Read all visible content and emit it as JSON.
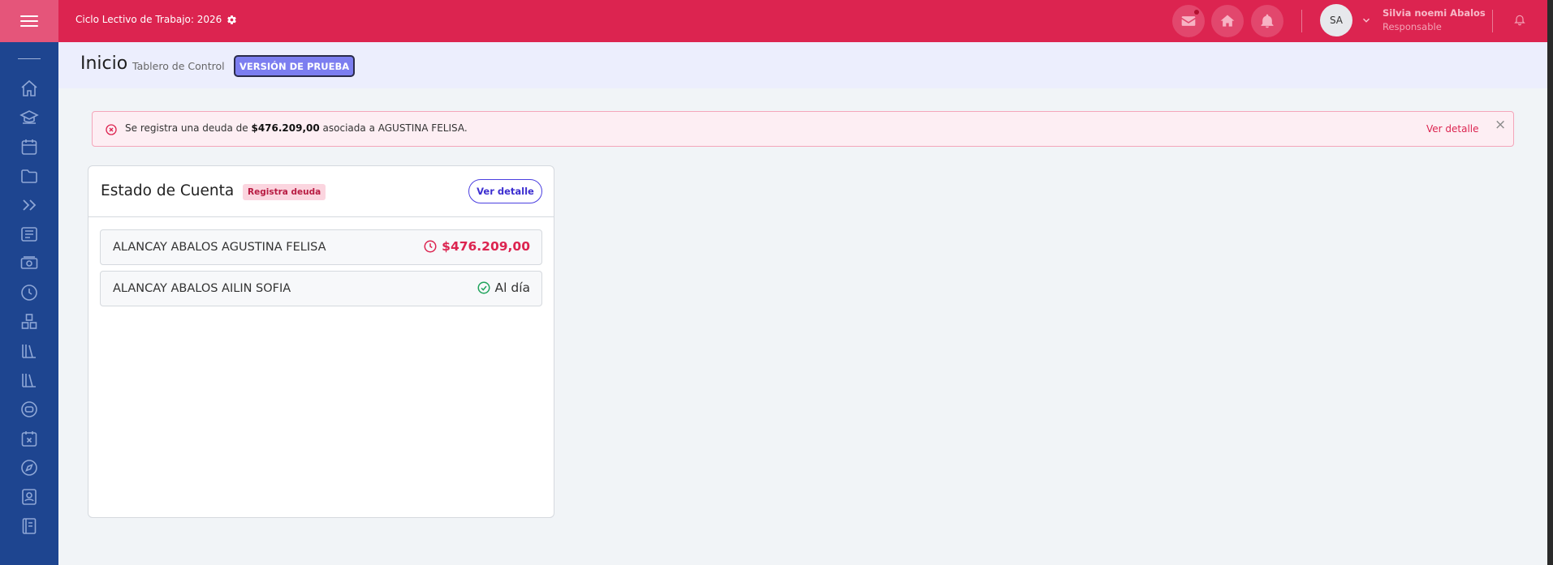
{
  "topbar": {
    "cycle_label": "Ciclo Lectivo de Trabajo: 2026",
    "user_initials": "SA",
    "user_name": "Silvia noemi Abalos",
    "user_role": "Responsable"
  },
  "sidebar": {
    "items": [
      {
        "icon": "home-icon"
      },
      {
        "icon": "graduation-icon"
      },
      {
        "icon": "calendar-icon"
      },
      {
        "icon": "folder-icon"
      },
      {
        "icon": "double-chevron-icon"
      },
      {
        "icon": "newspaper-icon"
      },
      {
        "icon": "money-icon"
      },
      {
        "icon": "clock-icon"
      },
      {
        "icon": "boxes-icon"
      },
      {
        "icon": "library-icon"
      },
      {
        "icon": "library-alt-icon"
      },
      {
        "icon": "ticket-icon"
      },
      {
        "icon": "calendar-x-icon"
      },
      {
        "icon": "compass-icon"
      },
      {
        "icon": "contact-icon"
      },
      {
        "icon": "notebook-icon"
      }
    ]
  },
  "header": {
    "title": "Inicio",
    "subtitle": "Tablero de Control",
    "badge": "VERSIÓN DE PRUEBA"
  },
  "alert": {
    "text_before": "Se registra una deuda de ",
    "amount": "$476.209,00",
    "text_after": " asociada a AGUSTINA FELISA.",
    "link": "Ver detalle",
    "close": "×"
  },
  "account_card": {
    "title": "Estado de Cuenta",
    "badge": "Registra deuda",
    "detail_button": "Ver detalle",
    "students": [
      {
        "name": "ALANCAY ABALOS AGUSTINA FELISA",
        "status": "$476.209,00",
        "status_type": "debt"
      },
      {
        "name": "ALANCAY ABALOS AILIN SOFIA",
        "status": "Al día",
        "status_type": "ok"
      }
    ]
  },
  "colors": {
    "primary": "#dc2450",
    "sidebar": "#1e4590",
    "accent": "#4b3fe0",
    "success": "#1fa35b"
  }
}
